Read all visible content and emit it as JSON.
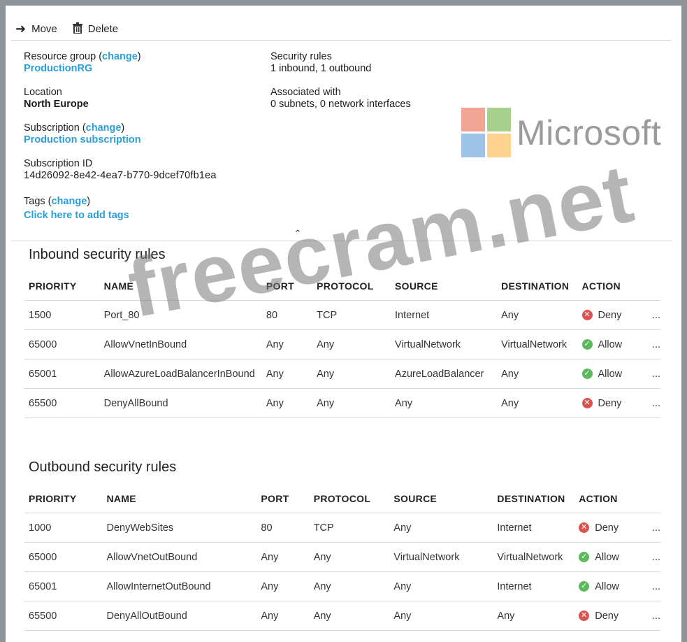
{
  "toolbar": {
    "move_label": "Move",
    "delete_label": "Delete"
  },
  "essentials": {
    "resource_group_label": "Resource group",
    "change_label": "change",
    "resource_group_value": "ProductionRG",
    "location_label": "Location",
    "location_value": "North Europe",
    "subscription_label": "Subscription",
    "subscription_value": "Production subscription",
    "subscription_id_label": "Subscription ID",
    "subscription_id_value": "14d26092-8e42-4ea7-b770-9dcef70fb1ea",
    "tags_label": "Tags",
    "tags_value": "Click here to add tags",
    "security_rules_label": "Security rules",
    "security_rules_value": "1 inbound, 1 outbound",
    "associated_label": "Associated with",
    "associated_value": "0 subnets, 0 network interfaces"
  },
  "logo": {
    "word": "Microsoft",
    "colors": [
      "#f1a493",
      "#a8d08d",
      "#9dc3e6",
      "#ffd28f"
    ]
  },
  "watermark": "freecram.net",
  "columns": [
    "PRIORITY",
    "NAME",
    "PORT",
    "PROTOCOL",
    "SOURCE",
    "DESTINATION",
    "ACTION"
  ],
  "inbound": {
    "title": "Inbound security rules",
    "rows": [
      {
        "priority": "1500",
        "name": "Port_80",
        "port": "80",
        "protocol": "TCP",
        "source": "Internet",
        "destination": "Any",
        "action": "Deny"
      },
      {
        "priority": "65000",
        "name": "AllowVnetInBound",
        "port": "Any",
        "protocol": "Any",
        "source": "VirtualNetwork",
        "destination": "VirtualNetwork",
        "action": "Allow"
      },
      {
        "priority": "65001",
        "name": "AllowAzureLoadBalancerInBound",
        "port": "Any",
        "protocol": "Any",
        "source": "AzureLoadBalancer",
        "destination": "Any",
        "action": "Allow"
      },
      {
        "priority": "65500",
        "name": "DenyAllBound",
        "port": "Any",
        "protocol": "Any",
        "source": "Any",
        "destination": "Any",
        "action": "Deny"
      }
    ]
  },
  "outbound": {
    "title": "Outbound security rules",
    "rows": [
      {
        "priority": "1000",
        "name": "DenyWebSites",
        "port": "80",
        "protocol": "TCP",
        "source": "Any",
        "destination": "Internet",
        "action": "Deny"
      },
      {
        "priority": "65000",
        "name": "AllowVnetOutBound",
        "port": "Any",
        "protocol": "Any",
        "source": "VirtualNetwork",
        "destination": "VirtualNetwork",
        "action": "Allow"
      },
      {
        "priority": "65001",
        "name": "AllowInternetOutBound",
        "port": "Any",
        "protocol": "Any",
        "source": "Any",
        "destination": "Internet",
        "action": "Allow"
      },
      {
        "priority": "65500",
        "name": "DenyAllOutBound",
        "port": "Any",
        "protocol": "Any",
        "source": "Any",
        "destination": "Any",
        "action": "Deny"
      }
    ]
  },
  "more_label": "..."
}
